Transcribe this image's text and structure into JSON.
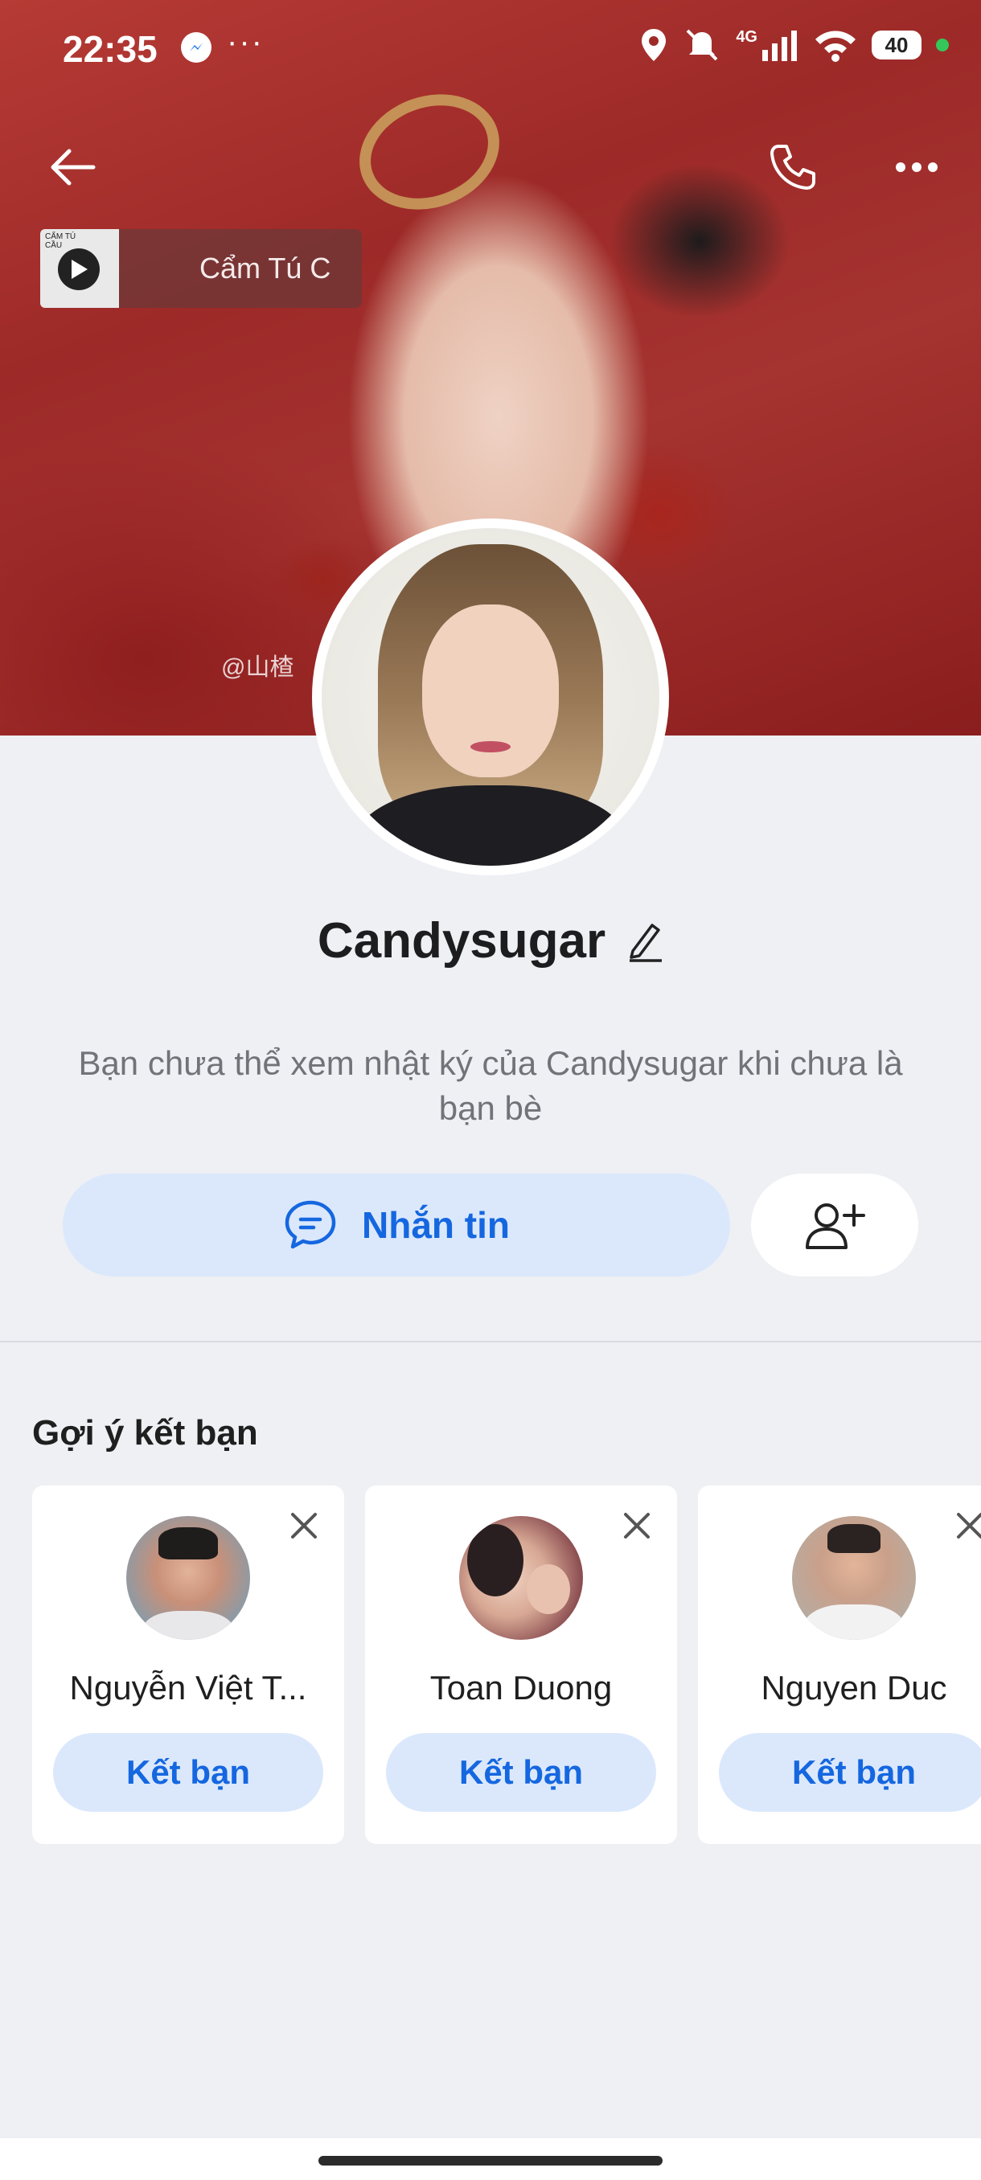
{
  "status_bar": {
    "time": "22:35",
    "more": "···",
    "network": "4G",
    "battery": "40",
    "icons": [
      "messenger-icon",
      "location-icon",
      "mute-icon",
      "signal-icon",
      "wifi-icon",
      "battery-icon"
    ]
  },
  "cover": {
    "watermark": "@山楂",
    "music": {
      "title": "Cẩm Tú C",
      "thumb_text": "CẨM TÚ CẦU"
    }
  },
  "profile": {
    "name": "Candysugar",
    "diary_note": "Bạn chưa thể xem nhật ký của Candysugar khi chưa là bạn bè",
    "message_label": "Nhắn tin"
  },
  "suggestions": {
    "title": "Gợi ý kết bạn",
    "add_label": "Kết bạn",
    "items": [
      {
        "name": "Nguyễn Việt T..."
      },
      {
        "name": "Toan Duong"
      },
      {
        "name": "Nguyen Duc"
      }
    ]
  },
  "colors": {
    "accent": "#1567e0",
    "button_bg": "#dbe8fc",
    "page_bg": "#eef0f4"
  }
}
